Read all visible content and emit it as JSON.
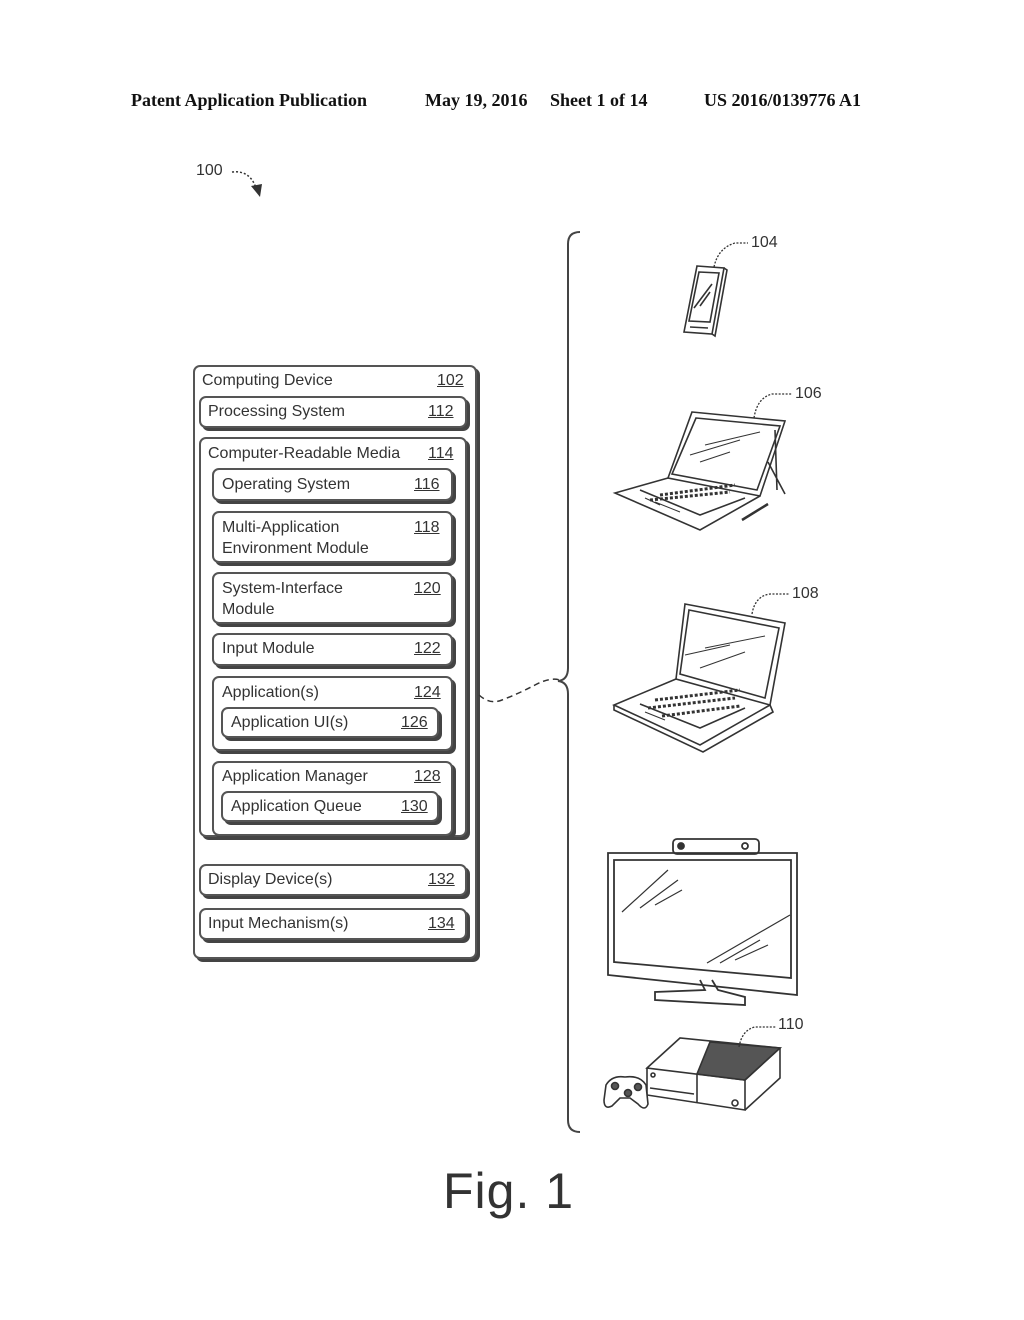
{
  "header": {
    "publication": "Patent Application Publication",
    "date": "May 19, 2016",
    "sheet": "Sheet 1 of 14",
    "number": "US 2016/0139776 A1"
  },
  "figure": {
    "system_ref": "100",
    "caption": "Fig. 1"
  },
  "computing_device": {
    "label": "Computing Device",
    "ref": "102",
    "processing_system": {
      "label": "Processing System",
      "ref": "112"
    },
    "crm": {
      "label": "Computer-Readable Media",
      "ref": "114",
      "modules": [
        {
          "label": "Operating System",
          "ref": "116"
        },
        {
          "label": "Multi-Application",
          "label2": "Environment Module",
          "ref": "118"
        },
        {
          "label": "System-Interface",
          "label2": "Module",
          "ref": "120"
        },
        {
          "label": "Input Module",
          "ref": "122"
        },
        {
          "label": "Application(s)",
          "ref": "124",
          "child": {
            "label": "Application UI(s)",
            "ref": "126"
          }
        },
        {
          "label": "Application Manager",
          "ref": "128",
          "child": {
            "label": "Application Queue",
            "ref": "130"
          }
        }
      ]
    },
    "display_devices": {
      "label": "Display Device(s)",
      "ref": "132"
    },
    "input_mechanisms": {
      "label": "Input Mechanism(s)",
      "ref": "134"
    }
  },
  "devices": [
    {
      "name": "smartphone",
      "ref": "104"
    },
    {
      "name": "tablet-with-keyboard",
      "ref": "106"
    },
    {
      "name": "laptop",
      "ref": "108"
    },
    {
      "name": "television-gaming-console",
      "ref": "110"
    }
  ]
}
